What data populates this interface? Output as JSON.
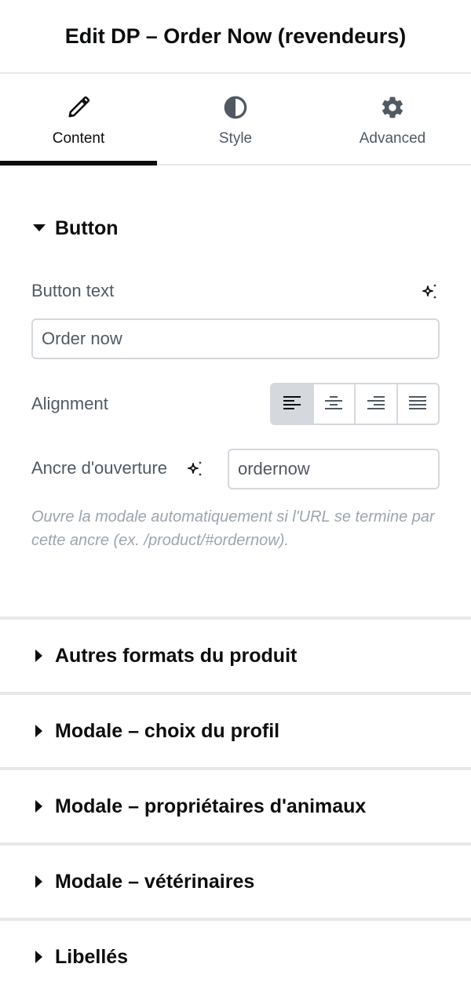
{
  "header": {
    "title": "Edit DP – Order Now (revendeurs)"
  },
  "tabs": [
    {
      "label": "Content",
      "icon": "pencil-icon",
      "active": true
    },
    {
      "label": "Style",
      "icon": "contrast-icon",
      "active": false
    },
    {
      "label": "Advanced",
      "icon": "gear-icon",
      "active": false
    }
  ],
  "button_section": {
    "title": "Button",
    "button_text": {
      "label": "Button text",
      "value": "Order now"
    },
    "alignment": {
      "label": "Alignment",
      "options": [
        "left",
        "center",
        "right",
        "justify"
      ],
      "selected": "left"
    },
    "anchor": {
      "label": "Ancre d'ouverture",
      "value": "ordernow"
    },
    "help": "Ouvre la modale automatiquement si l'URL se termine par cette ancre (ex. /product/#ordernow)."
  },
  "collapsed_sections": [
    {
      "title": "Autres formats du produit"
    },
    {
      "title": "Modale – choix du profil"
    },
    {
      "title": "Modale – propriétaires d'animaux"
    },
    {
      "title": "Modale – vétérinaires"
    },
    {
      "title": "Libellés"
    }
  ],
  "colors": {
    "text": "#0c0d0e",
    "label": "#515962",
    "border": "#d5d8dc",
    "divider": "#e6e8ea",
    "help": "#9da5ae"
  }
}
